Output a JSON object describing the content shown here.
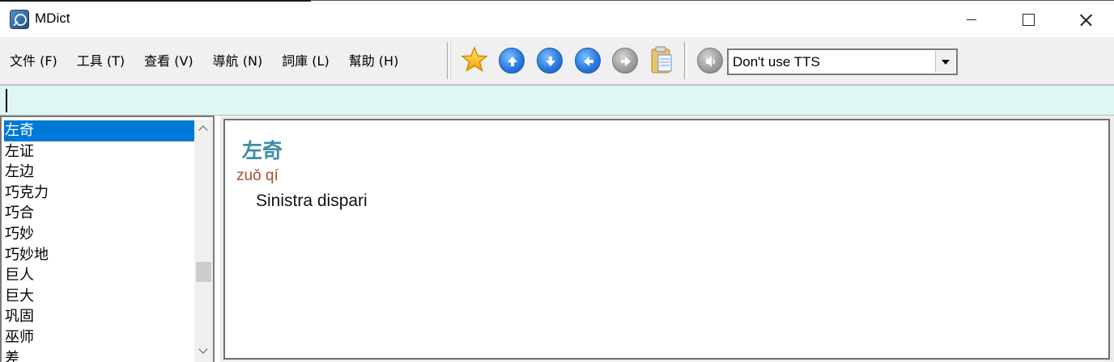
{
  "window": {
    "title": "MDict",
    "icon": "mdict-magnifier-icon"
  },
  "menu": [
    "文件 (F)",
    "工具 (T)",
    "查看 (V)",
    "導航 (N)",
    "詞庫 (L)",
    "幫助 (H)"
  ],
  "toolbar": {
    "icons": [
      "favorite-star-icon",
      "previous-up-icon",
      "next-down-icon",
      "back-icon",
      "forward-icon",
      "clipboard-icon",
      "speaker-icon"
    ],
    "tts_selected": "Don't use TTS"
  },
  "search": {
    "value": ""
  },
  "wordlist": {
    "selected_index": 0,
    "items": [
      "左奇",
      "左证",
      "左边",
      "巧克力",
      "巧合",
      "巧妙",
      "巧妙地",
      "巨人",
      "巨大",
      "巩固",
      "巫师",
      "差"
    ],
    "scroll_position": 0.58
  },
  "entry": {
    "headword": "左奇",
    "pinyin": "zuǒ qí",
    "definition": "Sinistra dispari"
  },
  "colors": {
    "headword": "#3b8fa6",
    "pinyin": "#a0522d",
    "selection": "#0078d7",
    "searchbar": "#dff7f4"
  }
}
